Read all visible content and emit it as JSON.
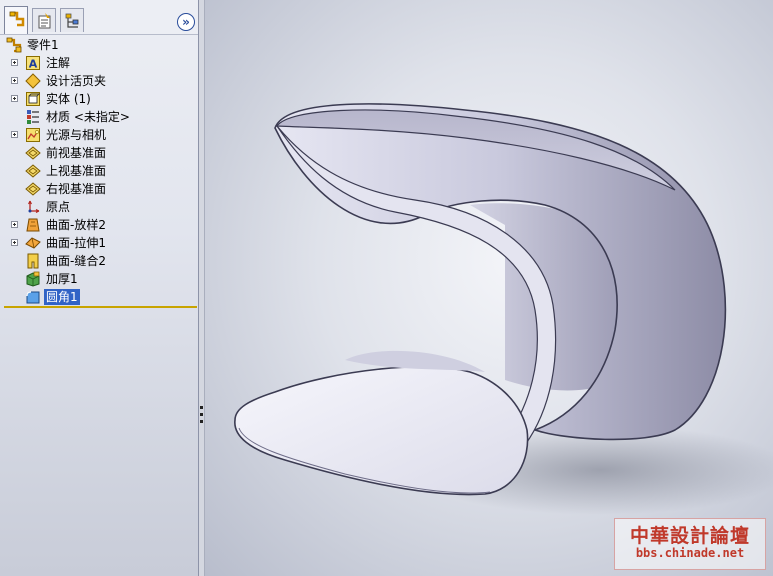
{
  "panel": {
    "tabs": [
      {
        "name": "feature-manager",
        "icon": "feature-tree-icon"
      },
      {
        "name": "property-manager",
        "icon": "property-manager-icon"
      },
      {
        "name": "configuration-manager",
        "icon": "configuration-manager-icon"
      }
    ],
    "expand_label": "»"
  },
  "tree": {
    "root": {
      "label": "零件1",
      "icon": "part-icon"
    },
    "items": [
      {
        "label": "注解",
        "icon": "annotations-icon",
        "expandable": true
      },
      {
        "label": "设计活页夹",
        "icon": "design-binder-icon",
        "expandable": true
      },
      {
        "label": "实体 (1)",
        "icon": "solid-bodies-icon",
        "expandable": true
      },
      {
        "label": "材质 <未指定>",
        "icon": "material-icon",
        "expandable": false
      },
      {
        "label": "光源与相机",
        "icon": "lights-cameras-icon",
        "expandable": true
      },
      {
        "label": "前视基准面",
        "icon": "plane-icon",
        "expandable": false
      },
      {
        "label": "上视基准面",
        "icon": "plane-icon",
        "expandable": false
      },
      {
        "label": "右视基准面",
        "icon": "plane-icon",
        "expandable": false
      },
      {
        "label": "原点",
        "icon": "origin-icon",
        "expandable": false
      },
      {
        "label": "曲面-放样2",
        "icon": "surface-loft-icon",
        "expandable": true
      },
      {
        "label": "曲面-拉伸1",
        "icon": "surface-extrude-icon",
        "expandable": true
      },
      {
        "label": "曲面-缝合2",
        "icon": "surface-knit-icon",
        "expandable": false
      },
      {
        "label": "加厚1",
        "icon": "thicken-icon",
        "expandable": false
      },
      {
        "label": "圆角1",
        "icon": "fillet-icon",
        "expandable": false,
        "selected": true
      }
    ]
  },
  "watermark": {
    "title": "中華設計論壇",
    "url": "bbs.chinade.net"
  }
}
